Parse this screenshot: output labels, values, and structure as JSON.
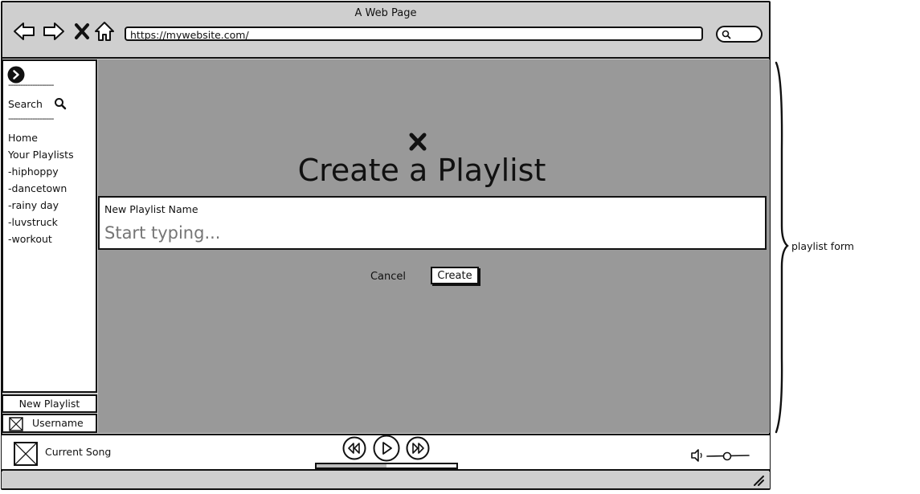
{
  "window": {
    "title": "A Web Page"
  },
  "address_bar": {
    "url": "https://mywebsite.com/"
  },
  "nav_icons": [
    "back-icon",
    "forward-icon",
    "close-icon",
    "home-icon"
  ],
  "sidebar": {
    "separator": "-------------------",
    "search_label": "Search",
    "items": [
      {
        "label": "Home"
      },
      {
        "label": "Your Playlists"
      },
      {
        "label": "-hiphoppy"
      },
      {
        "label": "-dancetown"
      },
      {
        "label": "-rainy day"
      },
      {
        "label": "-luvstruck"
      },
      {
        "label": "-workout"
      }
    ],
    "new_playlist_label": "New Playlist",
    "username": "Username"
  },
  "modal": {
    "title": "Create a Playlist",
    "field_label": "New Playlist Name",
    "field_placeholder": "Start typing...",
    "cancel_label": "Cancel",
    "create_label": "Create"
  },
  "player": {
    "current_song": "Current Song",
    "progress": 0.5,
    "controls": [
      "rewind-icon",
      "play-icon",
      "fast-forward-icon"
    ]
  },
  "annotation": {
    "label": "playlist form"
  },
  "colors": {
    "chrome": "#cfcfcf",
    "overlay": "#999999",
    "stroke": "#111111",
    "panel": "#ffffff"
  }
}
